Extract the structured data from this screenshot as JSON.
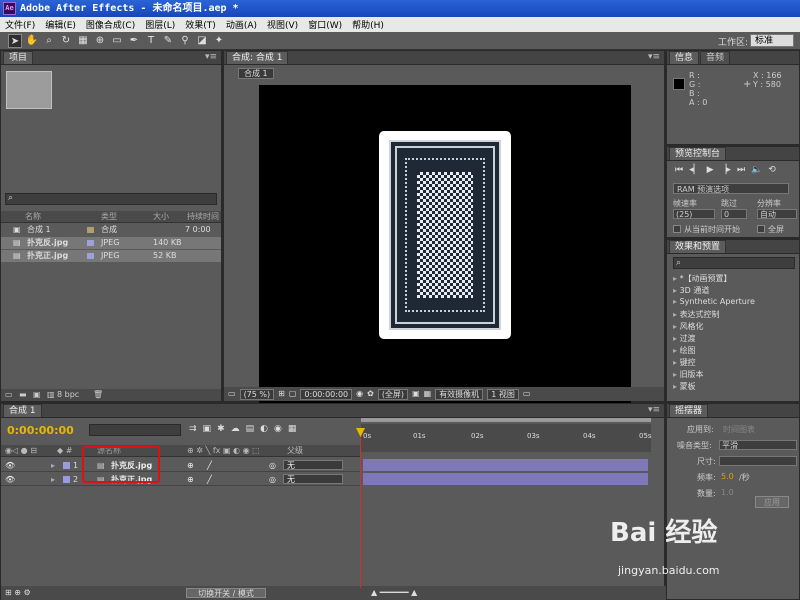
{
  "window": {
    "title": "Adobe After Effects - 未命名项目.aep *"
  },
  "menu": [
    "文件(F)",
    "编辑(E)",
    "图像合成(C)",
    "图层(L)",
    "效果(T)",
    "动画(A)",
    "视图(V)",
    "窗口(W)",
    "帮助(H)"
  ],
  "toolbar": {
    "workspace_label": "工作区:",
    "workspace_value": "标准"
  },
  "project": {
    "tab": "项目",
    "columns": {
      "name": "名称",
      "type": "类型",
      "size": "大小",
      "duration": "持续时间"
    },
    "items": [
      {
        "name": "合成 1",
        "type": "合成",
        "size": "",
        "duration": "7 0:00"
      },
      {
        "name": "扑克反.jpg",
        "type": "JPEG",
        "size": "140 KB",
        "duration": ""
      },
      {
        "name": "扑克正.jpg",
        "type": "JPEG",
        "size": "52 KB",
        "duration": ""
      }
    ],
    "bpc": "8 bpc"
  },
  "composition": {
    "tab": "合成: 合成 1",
    "subtab": "合成 1",
    "zoom": "(75 %)",
    "timecode": "0:00:00:00",
    "resolution": "(全屏)",
    "camera": "有效摄像机",
    "views": "1 视图"
  },
  "info": {
    "tabs": [
      "信息",
      "音频"
    ],
    "r": "R :",
    "g": "G :",
    "b": "B :",
    "a": "A : 0",
    "x": "X : 166",
    "y": "Y : 580"
  },
  "preview": {
    "tab": "预览控制台",
    "ram": "RAM 预演选项",
    "frame_rate_label": "帧速率",
    "skip_label": "跳过",
    "resolution_label": "分辨率",
    "frame_rate": "(25)",
    "skip": "0",
    "resolution": "自动",
    "from_current": "从当前时间开始",
    "fullscreen": "全屏"
  },
  "effects": {
    "tab": "效果和预置",
    "items": [
      "*【动画预置】",
      "3D 通道",
      "Synthetic Aperture",
      "表达式控制",
      "风格化",
      "过渡",
      "绘图",
      "键控",
      "旧版本",
      "蒙板"
    ]
  },
  "brush": {
    "tab": "摇摆器",
    "apply_to": "应用到:",
    "apply_to_value": "时间图表",
    "noise": "噪音类型:",
    "noise_value": "平滑",
    "dimension": "尺寸:",
    "freq": "频率:",
    "freq_value": "5.0",
    "freq_unit": "/秒",
    "amount": "数量:",
    "amount_value": "1.0",
    "apply_button": "应用"
  },
  "timeline": {
    "tab": "合成 1",
    "time": "0:00:00:00",
    "ticks": [
      "0s",
      "01s",
      "02s",
      "03s",
      "04s",
      "05s"
    ],
    "col_name": "源名称",
    "col_parent": "父级",
    "layers": [
      {
        "num": "1",
        "name": "扑克反.jpg",
        "parent": "无"
      },
      {
        "num": "2",
        "name": "扑克正.jpg",
        "parent": "无"
      }
    ],
    "toggle": "切换开关 / 模式"
  },
  "watermark": {
    "logo": "Bai 经验",
    "url": "jingyan.baidu.com"
  },
  "colors": {
    "accent": "#e6b800",
    "track": "#7e78b8",
    "highlight": "#e01010"
  }
}
